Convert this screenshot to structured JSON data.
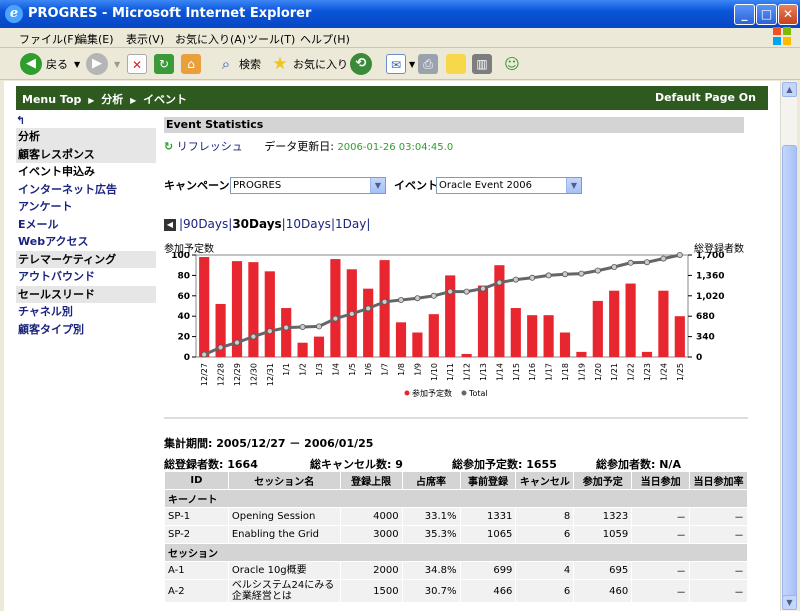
{
  "window": {
    "title": "PROGRES - Microsoft Internet Explorer"
  },
  "menu": [
    "ファイル(F)",
    "編集(E)",
    "表示(V)",
    "お気に入り(A)",
    "ツール(T)",
    "ヘルプ(H)"
  ],
  "toolbar": {
    "back_label": "戻る",
    "search_label": "検索",
    "favorites_label": "お気に入り"
  },
  "nav": {
    "menu_top": "Menu Top",
    "crumb1": "分析",
    "crumb2": "イベント",
    "default_page": "Default Page On"
  },
  "sidebar": {
    "items": [
      {
        "label": "分析",
        "style": "gray"
      },
      {
        "label": "顧客レスポンス",
        "style": "gray"
      },
      {
        "label": "イベント申込み",
        "style": "plain"
      },
      {
        "label": "インターネット広告",
        "style": "link"
      },
      {
        "label": "アンケート",
        "style": "link"
      },
      {
        "label": "Eメール",
        "style": "link"
      },
      {
        "label": "Webアクセス",
        "style": "link"
      },
      {
        "label": "テレマーケティング",
        "style": "gray"
      },
      {
        "label": "アウトバウンド",
        "style": "link"
      },
      {
        "label": "セールスリード",
        "style": "gray"
      },
      {
        "label": "チャネル別",
        "style": "link"
      },
      {
        "label": "顧客タイプ別",
        "style": "link"
      }
    ]
  },
  "main": {
    "section_title": "Event Statistics",
    "refresh_label": "リフレッシュ",
    "updated_label": "データ更新日:",
    "updated_value": "2006-01-26 03:04:45.0",
    "campaign_label": "キャンペーン",
    "campaign_value": "PROGRES",
    "event_label": "イベント",
    "event_value": "Oracle Event 2006",
    "range_90": "90Days",
    "range_30": "30Days",
    "range_10": "10Days",
    "range_1": "1Day",
    "left_axis_title": "参加予定数",
    "right_axis_title": "総登録者数",
    "period_label": "集計期間:",
    "period_value": "2005/12/27 － 2006/01/25",
    "total_reg": "総登録者数: 1664",
    "total_cancel": "総キャンセル数: 9",
    "total_planned": "総参加予定数:  1655",
    "total_attended": "総参加者数: N/A"
  },
  "colors": {
    "bar": "#e8262f",
    "line": "#666666",
    "point": "#cccccc",
    "nav": "#2e5a20"
  },
  "chart_data": {
    "type": "bar",
    "categories": [
      "12/27",
      "12/28",
      "12/29",
      "12/30",
      "12/31",
      "1/1",
      "1/2",
      "1/3",
      "1/4",
      "1/5",
      "1/6",
      "1/7",
      "1/8",
      "1/9",
      "1/10",
      "1/11",
      "1/12",
      "1/13",
      "1/14",
      "1/15",
      "1/16",
      "1/17",
      "1/18",
      "1/19",
      "1/20",
      "1/21",
      "1/22",
      "1/23",
      "1/24",
      "1/25"
    ],
    "series": [
      {
        "name": "参加予定数",
        "axis": "left",
        "type": "bar",
        "values": [
          98,
          52,
          94,
          93,
          84,
          48,
          14,
          20,
          96,
          86,
          67,
          95,
          34,
          24,
          42,
          80,
          3,
          70,
          90,
          48,
          41,
          41,
          24,
          5,
          55,
          65,
          72,
          5,
          65,
          40
        ]
      },
      {
        "name": "Total",
        "axis": "right",
        "type": "line",
        "values": [
          40,
          160,
          240,
          340,
          430,
          490,
          500,
          510,
          640,
          720,
          810,
          920,
          950,
          980,
          1020,
          1090,
          1090,
          1140,
          1240,
          1290,
          1320,
          1360,
          1380,
          1390,
          1440,
          1500,
          1570,
          1580,
          1640,
          1700
        ]
      }
    ],
    "left_ylim": [
      0,
      100
    ],
    "left_ticks": [
      "0",
      "20",
      "40",
      "60",
      "80",
      "100"
    ],
    "right_ylim": [
      0,
      1700
    ],
    "right_ticks": [
      "0",
      "340",
      "680",
      "1,020",
      "1,360",
      "1,700"
    ],
    "legend": "bottom",
    "grid": false
  },
  "table": {
    "headers": [
      "ID",
      "セッション名",
      "登録上限",
      "占席率",
      "事前登録",
      "キャンセル",
      "参加予定",
      "当日参加",
      "当日参加率"
    ],
    "groups": [
      {
        "name": "キーノート",
        "rows": [
          [
            "SP-1",
            "Opening Session",
            "4000",
            "33.1%",
            "1331",
            "8",
            "1323",
            "－",
            "－"
          ],
          [
            "SP-2",
            "Enabling the Grid",
            "3000",
            "35.3%",
            "1065",
            "6",
            "1059",
            "－",
            "－"
          ]
        ]
      },
      {
        "name": "セッション",
        "rows": [
          [
            "A-1",
            "Oracle 10g概要",
            "2000",
            "34.8%",
            "699",
            "4",
            "695",
            "－",
            "－"
          ],
          [
            "A-2",
            "ベルシステム24にみる企業経営とは",
            "1500",
            "30.7%",
            "466",
            "6",
            "460",
            "－",
            "－"
          ]
        ]
      }
    ]
  }
}
